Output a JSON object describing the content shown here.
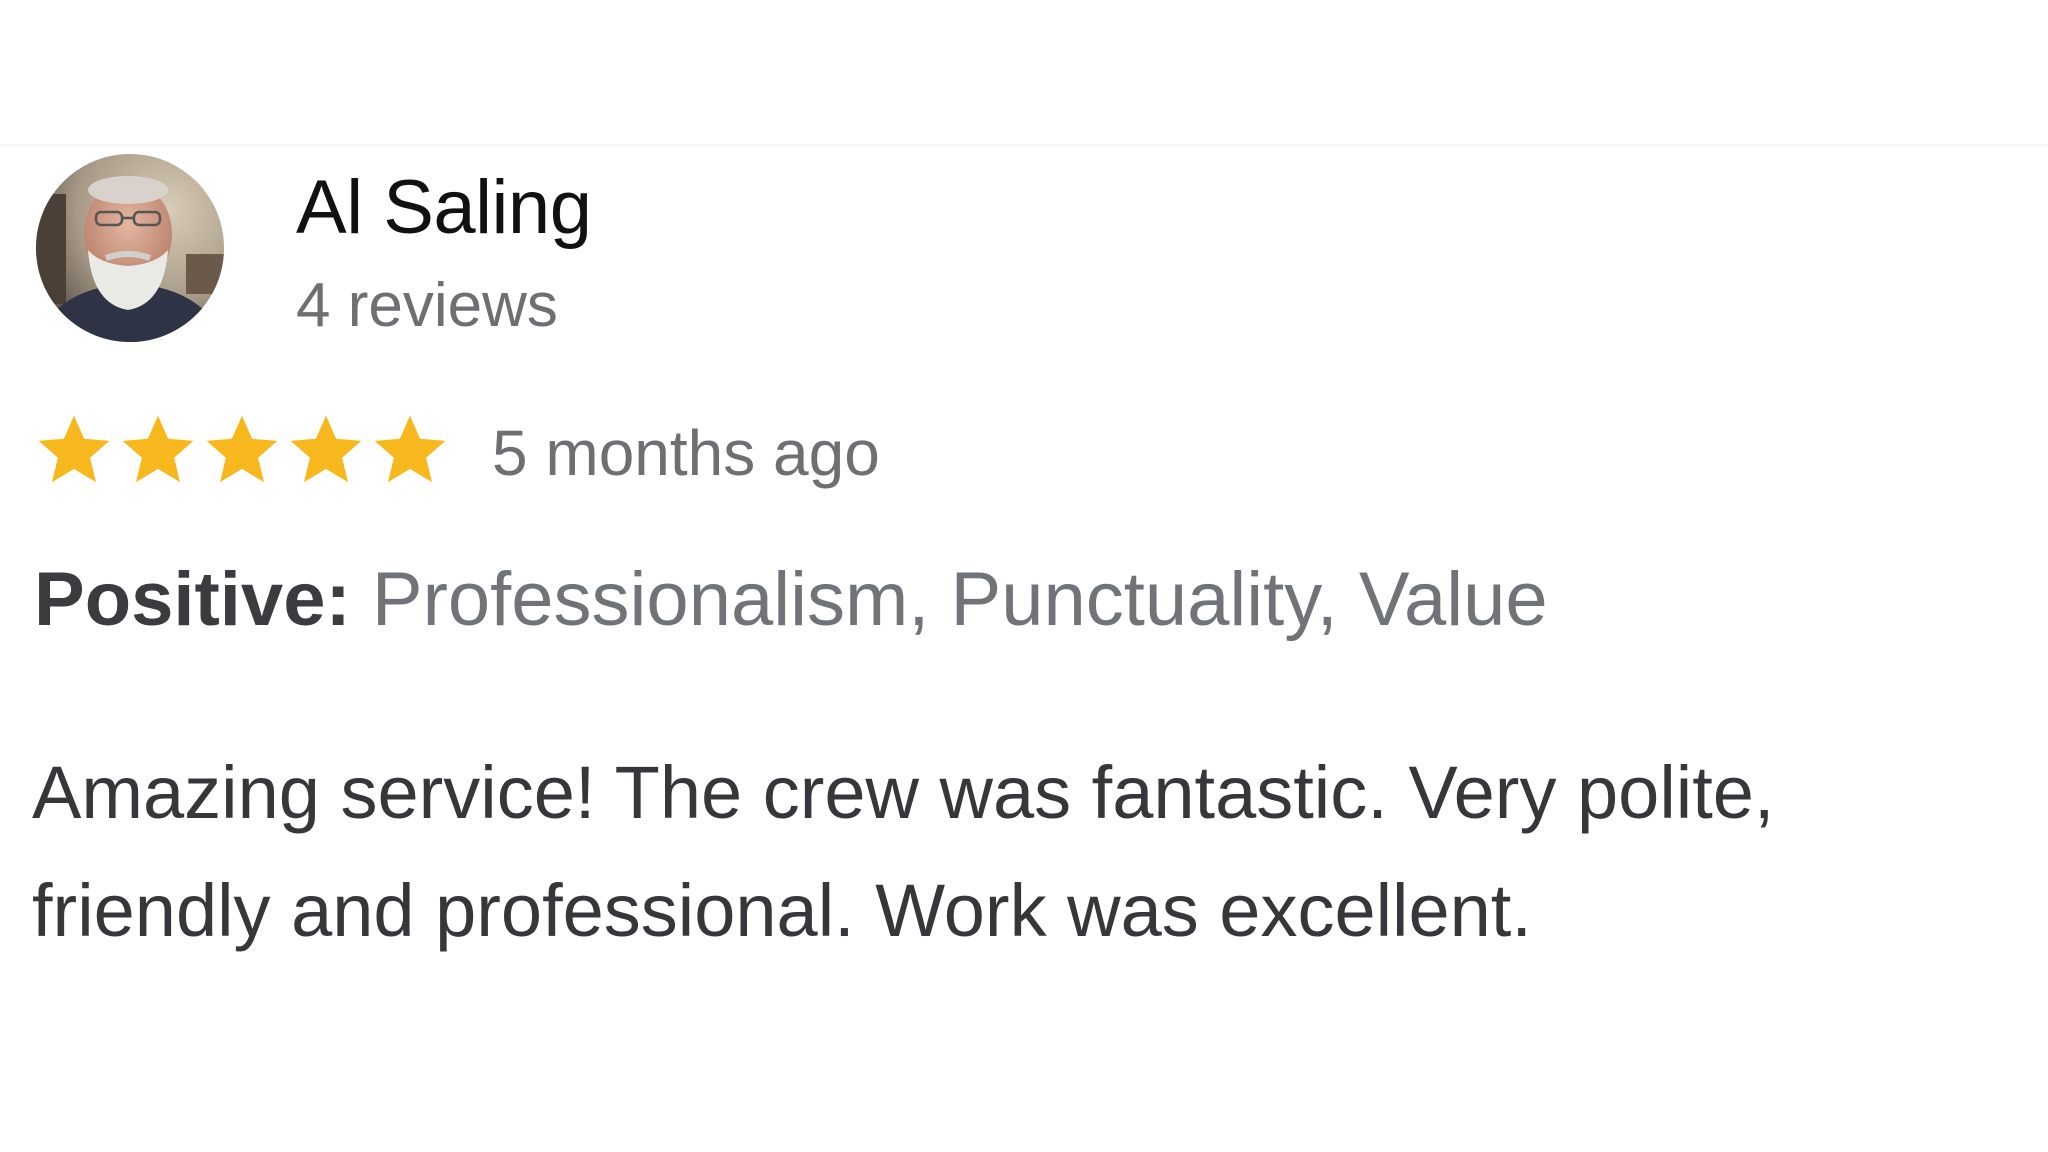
{
  "reviewer": {
    "name": "Al Saling",
    "review_count": "4 reviews",
    "avatar_icon": "reviewer-photo"
  },
  "rating": {
    "stars": 5,
    "max_stars": 5,
    "star_color": "#F6B81D",
    "date": "5 months ago"
  },
  "positive": {
    "label": "Positive:",
    "values": "Professionalism, Punctuality, Value"
  },
  "review": {
    "line1": "Amazing service! The crew was fantastic. Very polite,",
    "line2": "friendly and professional. Work was excellent."
  }
}
